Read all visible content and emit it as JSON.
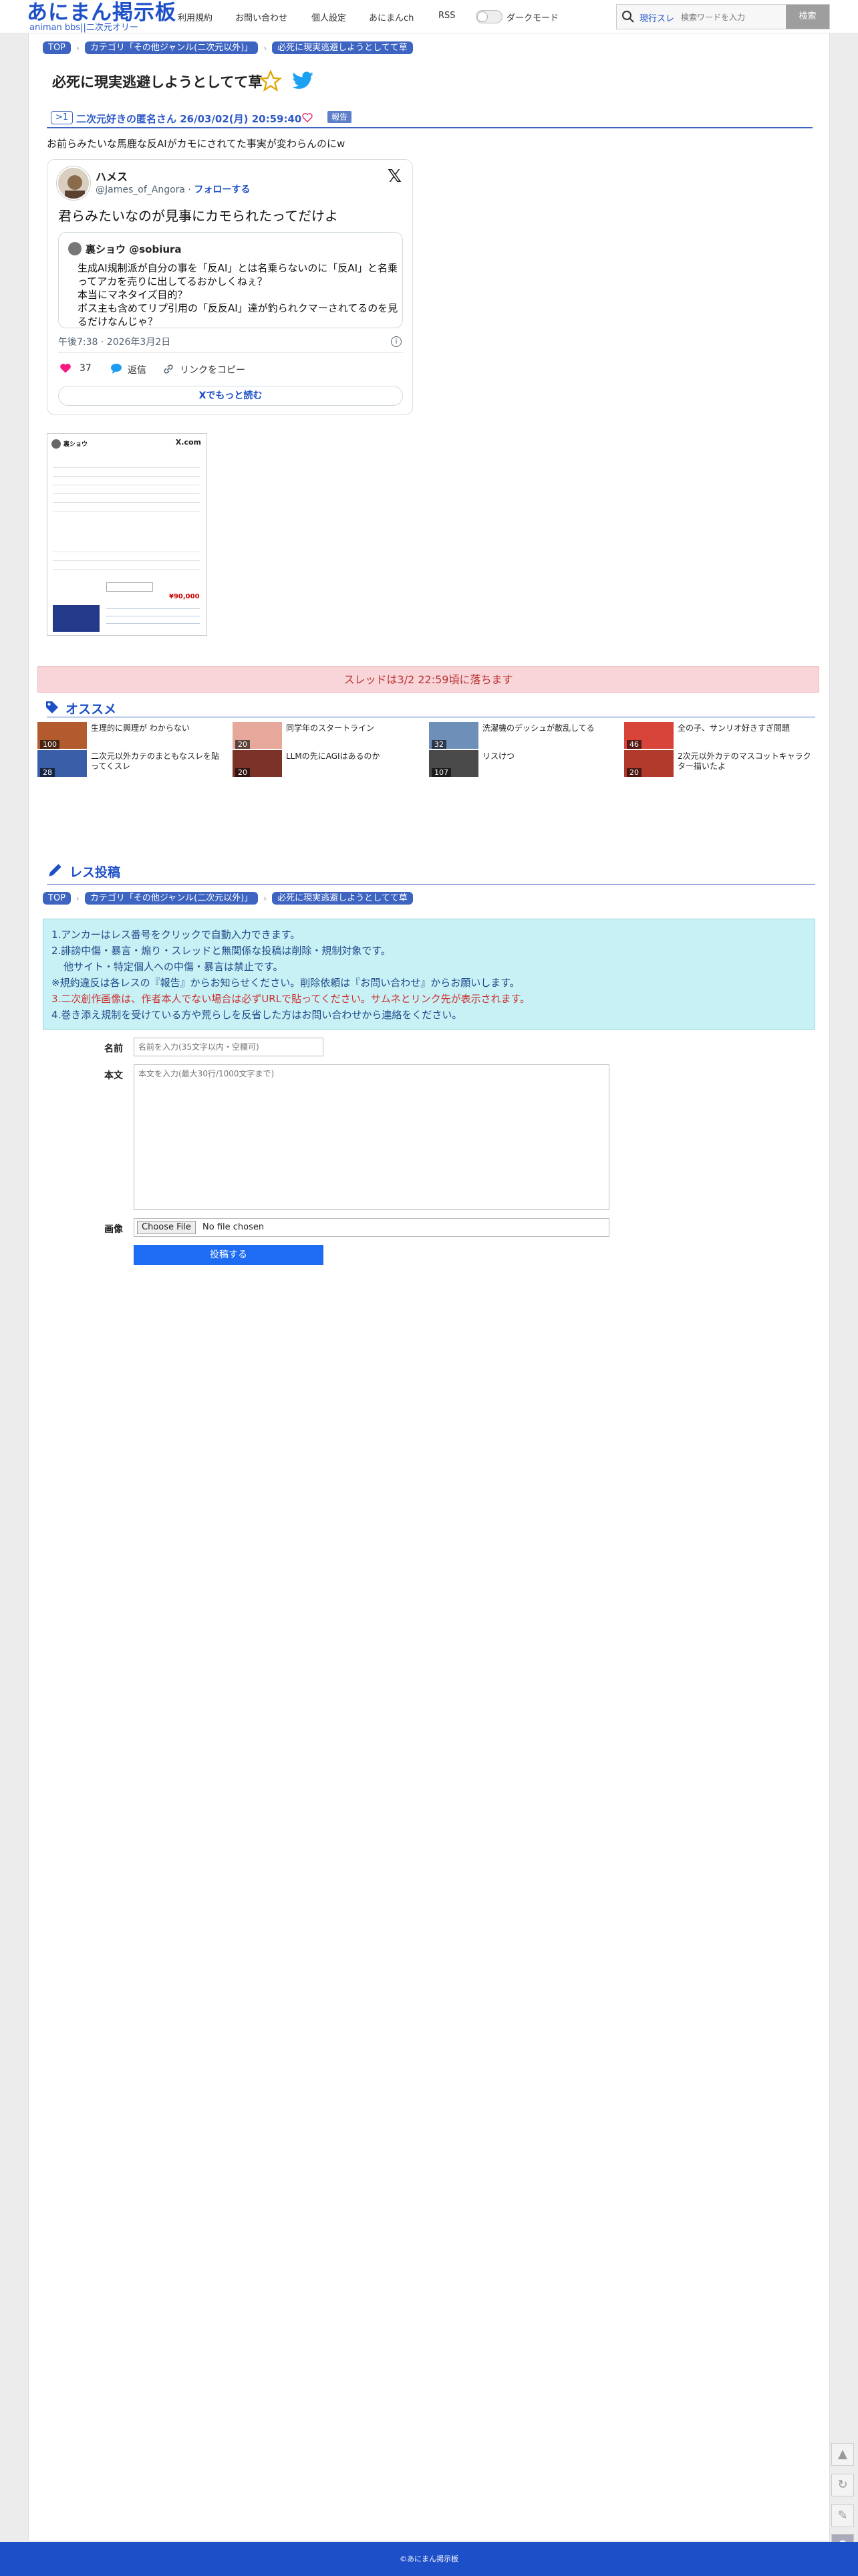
{
  "header": {
    "logo": "あにまん掲示板",
    "logo_sub": "animan bbs||二次元オリー",
    "nav": [
      "利用規約",
      "お問い合わせ",
      "個人設定",
      "あにまんch",
      "RSS"
    ],
    "dark_mode": "ダークモード",
    "search_scope": "現行スレ",
    "search_placeholder": "検索ワードを入力",
    "search_button": "検索"
  },
  "breadcrumb": {
    "top": "TOP",
    "category": "カテゴリ「その他ジャンル(二次元以外)」",
    "thread": "必死に現実逃避しようとしてて草"
  },
  "thread": {
    "title": "必死に現実逃避しようとしてて草"
  },
  "post": {
    "no": ">1",
    "author_date": "二次元好きの匿名さん 26/03/02(月) 20:59:40",
    "report": "報告",
    "body": "お前らみたいな馬鹿な反AIがカモにされてた事実が変わらんのにw"
  },
  "tweet": {
    "name": "ハメス",
    "handle": "@James_of_Angora ·",
    "follow": "フォローする",
    "x": "𝕏",
    "text": "君らみたいなのが見事にカモられたってだけよ",
    "quote_name": "裏ショウ @sobiura",
    "quote_lines": [
      "生成AI規制派が自分の事を「反AI」とは名乗らないのに「反AI」と名乗",
      "ってアカを売りに出してるおかしくねぇ？",
      "本当にマネタイズ目的？",
      "ボス主も含めてリプ引用の「反反AI」達が釣られクマーされてるのを見",
      "るだけなんじゃ？"
    ],
    "date": "午後7:38 · 2026年3月2日",
    "likes": "37",
    "reply": "返信",
    "copy": "リンクをコピー",
    "more": "Xでもっと読む"
  },
  "thumb": {
    "name": "裏ショウ",
    "x": "X.com",
    "price": "¥90,000"
  },
  "ending": "スレッドは3/2 22:59頃に落ちます",
  "osusume": {
    "title": "オススメ",
    "items": [
      {
        "caption": "生理的に興理が わからない",
        "count": "100"
      },
      {
        "caption": "同学年のスタートライン",
        "count": "20"
      },
      {
        "caption": "洗濯機のデッシュが散乱してる",
        "count": "32"
      },
      {
        "caption": "全の子、サンリオ好きすぎ問題",
        "count": "46"
      },
      {
        "caption": "二次元以外カテのまともなスレを貼ってくスレ",
        "count": "28"
      },
      {
        "caption": "LLMの先にAGIはあるのか",
        "count": "20"
      },
      {
        "caption": "リスけつ",
        "count": "107"
      },
      {
        "caption": "2次元以外カテのマスコットキャラクター描いたよ",
        "count": "20"
      }
    ]
  },
  "form": {
    "title": "レス投稿",
    "notices": [
      "1.アンカーはレス番号をクリックで自動入力できます。",
      "2.誹謗中傷・暴言・煽り・スレッドと無関係な投稿は削除・規制対象です。",
      "他サイト・特定個人への中傷・暴言は禁止です。",
      "※規約違反は各レスの『報告』からお知らせください。削除依頼は『お問い合わせ』からお願いします。",
      "3.二次創作画像は、作者本人でない場合は必ずURLで貼ってください。サムネとリンク先が表示されます。",
      "4.巻き添え規制を受けている方や荒らしを反省した方はお問い合わせから連絡をください。"
    ],
    "name_label": "名前",
    "name_placeholder": "名前を入力(35文字以内・空欄可)",
    "body_label": "本文",
    "body_placeholder": "本文を入力(最大30行/1000文字まで)",
    "image_label": "画像",
    "file_button": "Choose File",
    "file_none": "No file chosen",
    "submit": "投稿する"
  },
  "footer": "©あにまん掲示板",
  "colors": {
    "brand": "#1d4fc8",
    "notice_bg": "#c8f1f5",
    "ending_bg": "#f8d5d8"
  }
}
